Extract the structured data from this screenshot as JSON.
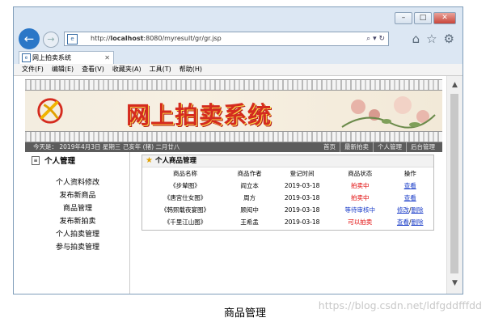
{
  "browser": {
    "url_prefix": "http://",
    "url_host": "localhost",
    "url_path": ":8080/myresult/gr/gr.jsp",
    "tab_title": "网上拍卖系统",
    "menu": [
      "文件(F)",
      "编辑(E)",
      "查看(V)",
      "收藏夹(A)",
      "工具(T)",
      "帮助(H)"
    ]
  },
  "site": {
    "title": "网上拍卖系统",
    "date_text": "今天是：   2019年4月3日  星期三  己亥年 (猪) 二月廿八",
    "nav_links": [
      "首页",
      "最新拍卖",
      "个人管理",
      "后台管理"
    ]
  },
  "sidebar": {
    "heading": "个人管理",
    "items": [
      "个人资料修改",
      "发布新商品",
      "商品管理",
      "发布新拍卖",
      "个人拍卖管理",
      "参与拍卖管理"
    ]
  },
  "main": {
    "heading": "个人商品管理",
    "columns": [
      "商品名称",
      "商品作者",
      "登记时间",
      "商品状态",
      "操作"
    ],
    "rows": [
      {
        "name": "《步辇图》",
        "author": "阎立本",
        "date": "2019-03-18",
        "status": "拍卖中",
        "action1": "查看",
        "action2": ""
      },
      {
        "name": "《唐宫仕女图》",
        "author": "周方",
        "date": "2019-03-18",
        "status": "拍卖中",
        "action1": "查看",
        "action2": ""
      },
      {
        "name": "《韩熙载夜宴图》",
        "author": "顾闳中",
        "date": "2019-03-18",
        "status": "等待审核中",
        "action1": "修改",
        "action2": "删除"
      },
      {
        "name": "《千里江山图》",
        "author": "王希孟",
        "date": "2019-03-18",
        "status": "可以拍卖",
        "action1": "查看",
        "action2": "删除"
      }
    ]
  },
  "caption": "商品管理",
  "watermark": "https://blog.csdn.net/ldfgddfffdd",
  "colors": {
    "status_red": "#e00000",
    "status_blue": "#1a3cc8",
    "title_red": "#d52b1e"
  }
}
